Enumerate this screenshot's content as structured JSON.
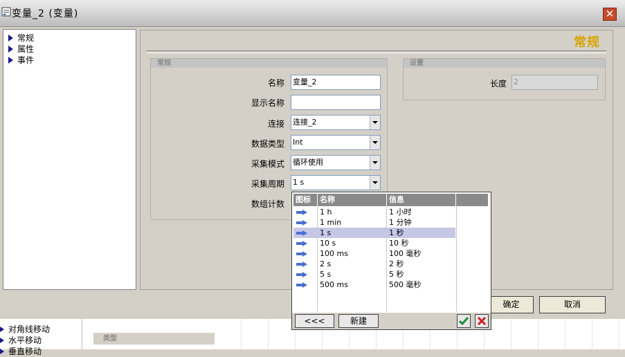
{
  "window": {
    "title": "变量_2 (变量)",
    "close_glyph": "✕"
  },
  "tree": {
    "items": [
      "常规",
      "属性",
      "事件"
    ]
  },
  "main": {
    "heading": "常规"
  },
  "general_group": {
    "title": "常规",
    "labels": {
      "name": "名称",
      "display_name": "显示名称",
      "connection": "连接",
      "data_type": "数据类型",
      "acquisition_mode": "采集模式",
      "acquisition_cycle": "采集周期",
      "array_count": "数组计数"
    },
    "values": {
      "name": "变量_2",
      "display_name": "",
      "connection": "连接_2",
      "data_type": "Int",
      "acquisition_mode": "循环使用",
      "acquisition_cycle": "1 s"
    }
  },
  "settings_group": {
    "title": "设置",
    "length_label": "长度",
    "length_value": "2"
  },
  "buttons": {
    "ok": "确定",
    "cancel": "取消"
  },
  "popup": {
    "columns": [
      "图标",
      "名称",
      "信息"
    ],
    "rows": [
      {
        "name": "1 h",
        "info": "1 小时"
      },
      {
        "name": "1 min",
        "info": "1 分钟"
      },
      {
        "name": "1 s",
        "info": "1 秒"
      },
      {
        "name": "10 s",
        "info": "10 秒"
      },
      {
        "name": "100 ms",
        "info": "100 毫秒"
      },
      {
        "name": "2 s",
        "info": "2 秒"
      },
      {
        "name": "5 s",
        "info": "5 秒"
      },
      {
        "name": "500 ms",
        "info": "500 毫秒"
      }
    ],
    "selected_index": 2,
    "back_label": "<<<",
    "new_label": "新建",
    "icons": {
      "row": "arrow-right-icon",
      "confirm": "check-icon",
      "cancel": "x-icon"
    }
  },
  "background": {
    "items": [
      "对角线移动",
      "水平移动",
      "垂直移动"
    ],
    "type_header": "类型"
  },
  "colors": {
    "heading": "#d8a300",
    "selection": "#c6c6e6",
    "close": "#c74a2c"
  }
}
